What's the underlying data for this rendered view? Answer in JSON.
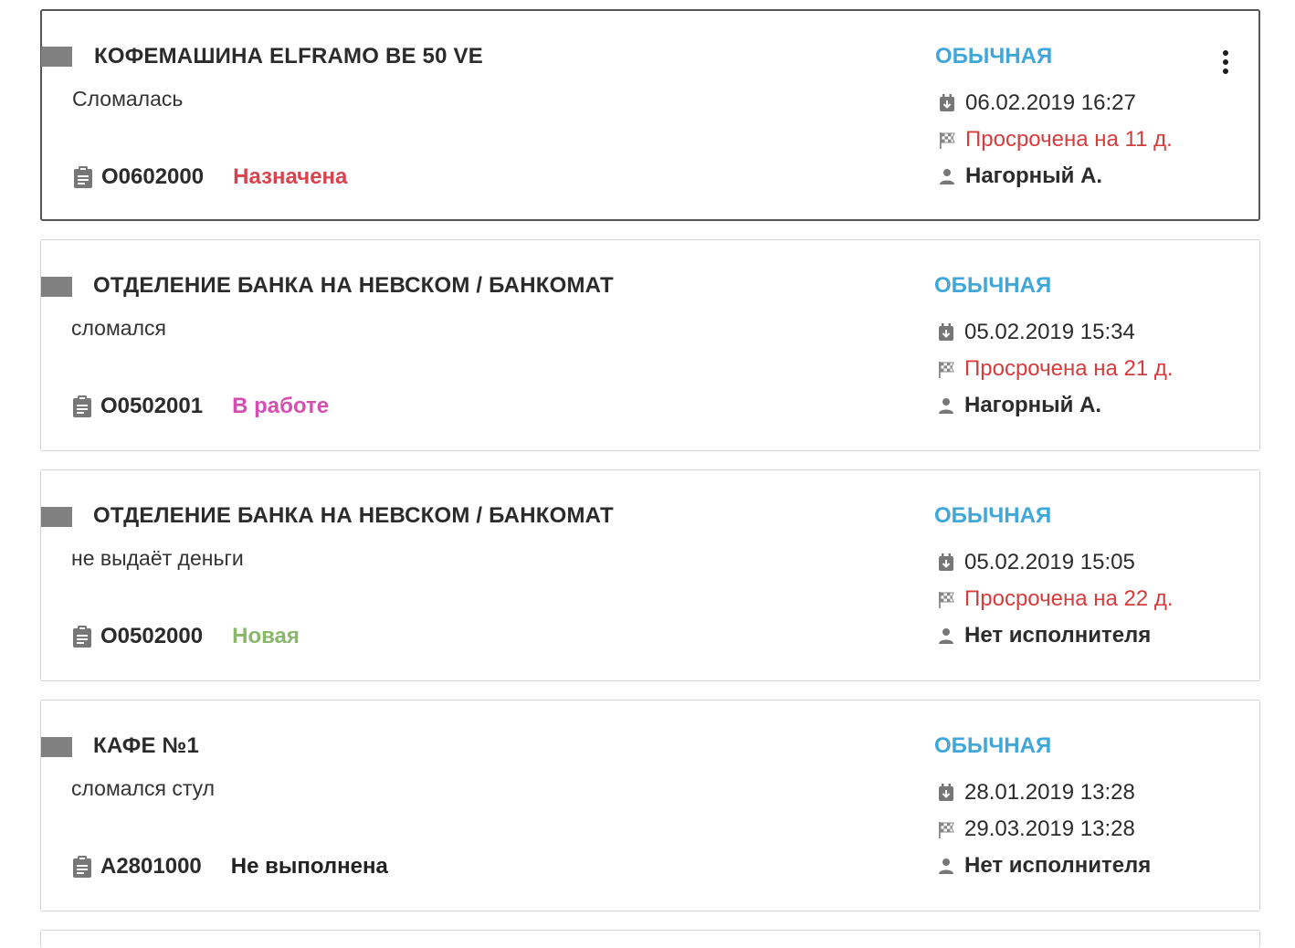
{
  "colors": {
    "priority": "#3fa7d9",
    "overdue": "#d63c3c",
    "status_assigned": "#d9434e",
    "status_in_progress": "#d44fb1",
    "status_new": "#8ab86b",
    "status_not_done": "#222222",
    "marker": "#808080"
  },
  "icons": {
    "order": "clipboard-icon",
    "created": "calendar-icon",
    "deadline": "checkered-flag-icon",
    "assignee": "person-icon",
    "menu": "more-vertical-icon"
  },
  "tickets": [
    {
      "title": "КОФЕМАШИНА ELFRAMO BE 50 VE",
      "description": "Сломалась",
      "number": "О0602000",
      "status": "Назначена",
      "status_color": "#d9434e",
      "priority": "ОБЫЧНАЯ",
      "created": "06.02.2019 16:27",
      "deadline": "Просрочена на 11 д.",
      "deadline_overdue": true,
      "assignee": "Нагорный А.",
      "selected": true
    },
    {
      "title": "ОТДЕЛЕНИЕ БАНКА НА НЕВСКОМ / БАНКОМАТ",
      "description": "сломался",
      "number": "О0502001",
      "status": "В работе",
      "status_color": "#d44fb1",
      "priority": "ОБЫЧНАЯ",
      "created": "05.02.2019 15:34",
      "deadline": "Просрочена на 21 д.",
      "deadline_overdue": true,
      "assignee": "Нагорный А.",
      "selected": false
    },
    {
      "title": "ОТДЕЛЕНИЕ БАНКА НА НЕВСКОМ / БАНКОМАТ",
      "description": "не выдаёт деньги",
      "number": "О0502000",
      "status": "Новая",
      "status_color": "#8ab86b",
      "priority": "ОБЫЧНАЯ",
      "created": "05.02.2019 15:05",
      "deadline": "Просрочена на 22 д.",
      "deadline_overdue": true,
      "assignee": "Нет исполнителя",
      "selected": false
    },
    {
      "title": "КАФЕ №1",
      "description": "сломался стул",
      "number": "А2801000",
      "status": "Не выполнена",
      "status_color": "#222222",
      "priority": "ОБЫЧНАЯ",
      "created": "28.01.2019 13:28",
      "deadline": "29.03.2019 13:28",
      "deadline_overdue": false,
      "assignee": "Нет исполнителя",
      "selected": false
    }
  ]
}
